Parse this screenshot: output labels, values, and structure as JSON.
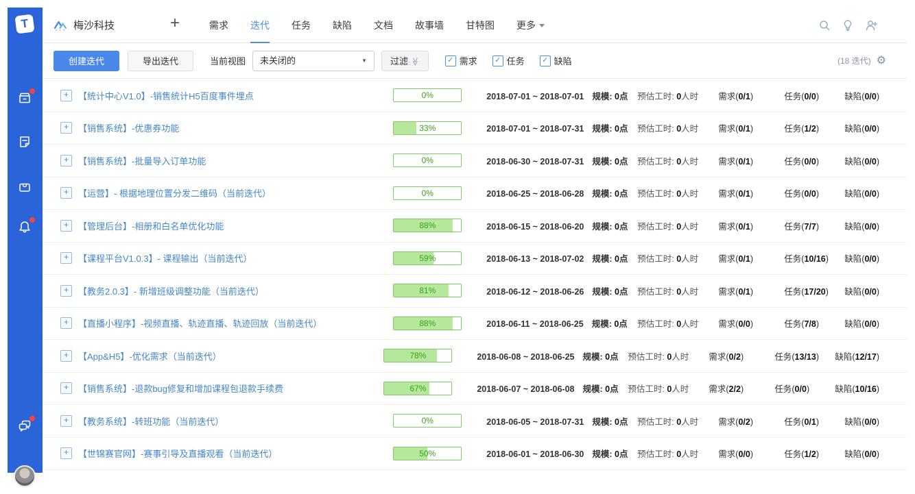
{
  "colors": {
    "sidebar_blue": "#2b63d9",
    "accent_blue": "#4a90e2",
    "button_blue": "#4a87e8",
    "progress_fill": "#b5e79c",
    "progress_border": "#82c964",
    "progress_text": "#3da01e",
    "badge_red": "#f4473b",
    "title_link": "#4687c8"
  },
  "sidebar": {
    "logo_letter": "T",
    "icons": [
      "projects-box-icon",
      "document-icon",
      "inbox-icon",
      "bell-icon",
      "chat-icon"
    ]
  },
  "header": {
    "project_name": "梅沙科技",
    "plus_label": "+",
    "nav": [
      "需求",
      "迭代",
      "任务",
      "缺陷",
      "文档",
      "故事墙",
      "甘特图",
      "更多"
    ],
    "active_tab": "迭代",
    "right_icons": [
      "search-icon",
      "bulb-icon",
      "add-person-icon"
    ]
  },
  "toolbar": {
    "create_button": "创建迭代",
    "export_button": "导出迭代",
    "view_label": "当前视图",
    "view_value": "未关闭的",
    "filter_button": "过滤",
    "filter_chevrons": "≫",
    "checkboxes": [
      "需求",
      "任务",
      "缺陷"
    ],
    "checkbox_checked": [
      true,
      true,
      true
    ],
    "check_glyph": "✓",
    "count_text": "(18 迭代)",
    "gear_glyph": "⚙"
  },
  "labels": {
    "scale": "规模:",
    "scale_unit": "点",
    "hours": "预估工时:",
    "hours_unit": "人时",
    "req": "需求",
    "task": "任务",
    "defect": "缺陷",
    "paren_open": "(",
    "paren_close": ")"
  },
  "iterations": [
    {
      "title": "【统计中心V1.0】-销售统计H5百度事件埋点",
      "pct": 0,
      "pct_text": "0%",
      "dates": "2018-07-01 ~ 2018-07-01",
      "scale": "0",
      "hours": "0",
      "req": "0/1",
      "task": "0/0",
      "defect": "0/0"
    },
    {
      "title": "【销售系统】-优惠券功能",
      "pct": 33,
      "pct_text": "33%",
      "dates": "2018-07-01 ~ 2018-07-31",
      "scale": "0",
      "hours": "0",
      "req": "0/1",
      "task": "1/2",
      "defect": "0/0"
    },
    {
      "title": "【销售系统】-批量导入订单功能",
      "pct": 0,
      "pct_text": "0%",
      "dates": "2018-06-30 ~ 2018-07-31",
      "scale": "0",
      "hours": "0",
      "req": "0/1",
      "task": "0/0",
      "defect": "0/0"
    },
    {
      "title": "【运营】- 根据地理位置分发二维码（当前迭代）",
      "pct": 0,
      "pct_text": "0%",
      "dates": "2018-06-25 ~ 2018-06-28",
      "scale": "0",
      "hours": "0",
      "req": "0/1",
      "task": "0/0",
      "defect": "0/0"
    },
    {
      "title": "【管理后台】-相册和白名单优化功能",
      "pct": 88,
      "pct_text": "88%",
      "dates": "2018-06-15 ~ 2018-06-20",
      "scale": "0",
      "hours": "0",
      "req": "0/1",
      "task": "7/7",
      "defect": "0/0"
    },
    {
      "title": "【课程平台V1.0.3】- 课程输出（当前迭代）",
      "pct": 59,
      "pct_text": "59%",
      "dates": "2018-06-13 ~ 2018-07-02",
      "scale": "0",
      "hours": "0",
      "req": "0/1",
      "task": "10/16",
      "defect": "0/0"
    },
    {
      "title": "【教务2.0.3】- 新增班级调整功能（当前迭代）",
      "pct": 81,
      "pct_text": "81%",
      "dates": "2018-06-12 ~ 2018-06-26",
      "scale": "0",
      "hours": "0",
      "req": "0/1",
      "task": "17/20",
      "defect": "0/0"
    },
    {
      "title": "【直播小程序】-视频直播、轨迹直播、轨迹回放（当前迭代）",
      "pct": 88,
      "pct_text": "88%",
      "dates": "2018-06-11 ~ 2018-06-25",
      "scale": "0",
      "hours": "0",
      "req": "0/0",
      "task": "7/8",
      "defect": "0/0"
    },
    {
      "title": "【App&H5】-优化需求（当前迭代）",
      "pct": 78,
      "pct_text": "78%",
      "dates": "2018-06-08 ~ 2018-06-25",
      "scale": "0",
      "hours": "0",
      "req": "0/2",
      "task": "13/13",
      "defect": "12/17"
    },
    {
      "title": "【销售系统】-退款bug修复和增加课程包退款手续费",
      "pct": 67,
      "pct_text": "67%",
      "dates": "2018-06-07 ~ 2018-06-08",
      "scale": "0",
      "hours": "0",
      "req": "2/2",
      "task": "0/0",
      "defect": "10/16"
    },
    {
      "title": "【教务系统】-转班功能（当前迭代）",
      "pct": 0,
      "pct_text": "0%",
      "dates": "2018-06-05 ~ 2018-07-31",
      "scale": "0",
      "hours": "0",
      "req": "0/2",
      "task": "0/1",
      "defect": "0/0"
    },
    {
      "title": "【世锦赛官网】-赛事引导及直播观看（当前迭代）",
      "pct": 50,
      "pct_text": "50%",
      "dates": "2018-06-01 ~ 2018-06-30",
      "scale": "0",
      "hours": "0",
      "req": "0/0",
      "task": "1/2",
      "defect": "0/0"
    }
  ]
}
